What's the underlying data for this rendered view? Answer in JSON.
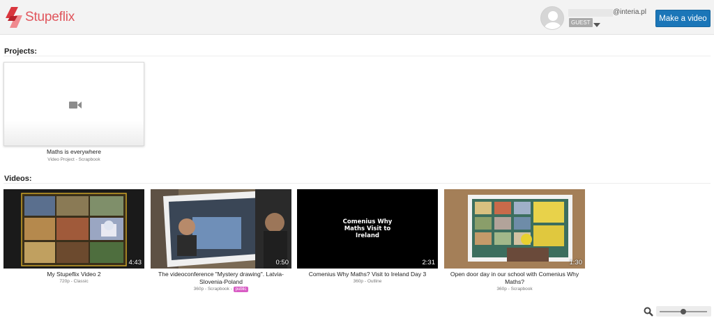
{
  "header": {
    "brand": "Stupeflix",
    "user_email_domain": "@interia.pl",
    "role_badge": "GUEST",
    "make_video_label": "Make a video"
  },
  "projects": {
    "title": "Projects:",
    "items": [
      {
        "title": "Maths is everywhere",
        "meta": "Video Project - Scrapbook"
      }
    ]
  },
  "videos": {
    "title": "Videos:",
    "items": [
      {
        "title": "My Stupeflix Video 2",
        "meta": "720p - Classic",
        "duration": "4:43",
        "badge": ""
      },
      {
        "title": "The videoconference \"Mystery drawing\". Latvia-Slovenia-Poland",
        "meta": "360p - Scrapbook - ",
        "duration": "0:50",
        "badge": "public"
      },
      {
        "title": "Comenius Why Maths? Visit to Ireland Day 3",
        "meta": "360p - Outline",
        "duration": "2:31",
        "badge": "",
        "thumb_text": "Comenius Why Maths Visit to Ireland"
      },
      {
        "title": "Open door day in our school with Comenius Why Maths?",
        "meta": "360p - Scrapbook",
        "duration": "1:30",
        "badge": ""
      }
    ]
  },
  "zoom": {
    "level": 0.5
  },
  "colors": {
    "brand": "#e0555c",
    "button": "#1b76b8",
    "public_badge": "#d85cc4"
  }
}
